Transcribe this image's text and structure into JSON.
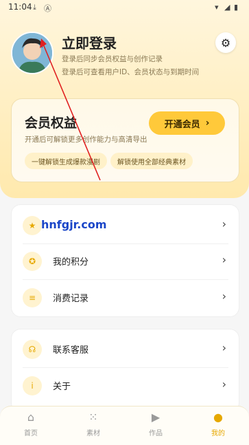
{
  "status": {
    "time": "11:04"
  },
  "profile": {
    "title": "立即登录",
    "subtitle_1": "登录后同步会员权益与创作记录",
    "subtitle_2": "登录后可查看用户ID、会员状态与到期时间"
  },
  "member": {
    "title": "会员权益",
    "description": "开通后可解锁更多创作能力与高清导出",
    "button_label": "开通会员",
    "pills": [
      "一键解锁生成爆款漫剧",
      "解锁使用全部经典素材"
    ]
  },
  "watermark": "hnfgjr.com",
  "menu_group_1": [
    {
      "label": "我的积分",
      "icon": "star-coin-icon"
    },
    {
      "label": "消费记录",
      "icon": "receipt-icon"
    }
  ],
  "menu_group_2": [
    {
      "label": "联系客服",
      "icon": "headset-icon"
    },
    {
      "label": "关于",
      "icon": "info-icon"
    }
  ],
  "nav": [
    {
      "label": "首页",
      "icon": "home-icon"
    },
    {
      "label": "素材",
      "icon": "grid-icon"
    },
    {
      "label": "作品",
      "icon": "play-icon"
    },
    {
      "label": "我的",
      "icon": "user-icon",
      "active": true
    }
  ],
  "colors": {
    "accent": "#ffc93a",
    "nav_active": "#e6a800"
  }
}
